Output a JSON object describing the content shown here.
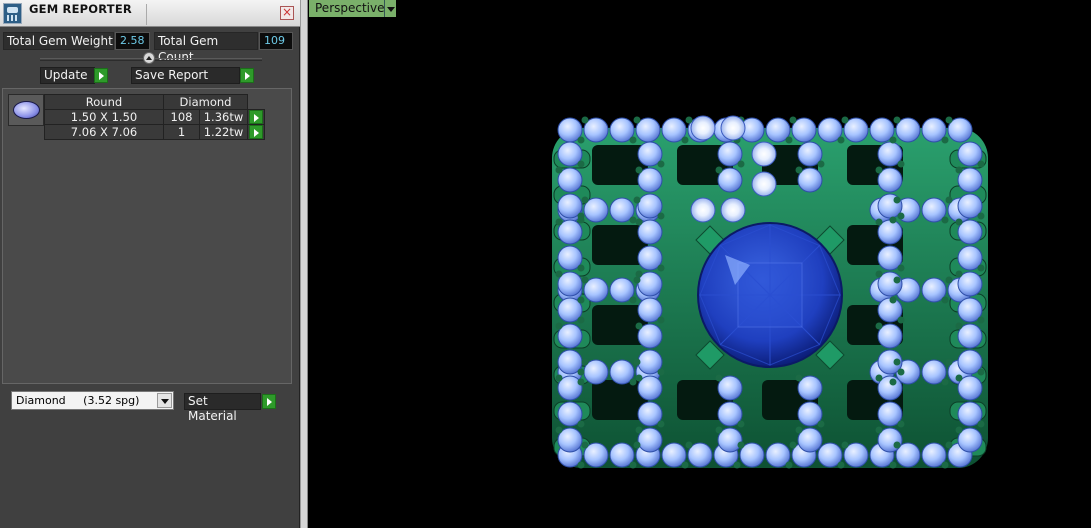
{
  "panel": {
    "title": "GEM REPORTER",
    "close_label": "×",
    "total_weight_label": "Total Gem Weight",
    "total_weight_value": "2.58",
    "total_count_label": "Total Gem Count",
    "total_count_value": "109",
    "update_label": "Update",
    "save_report_label": "Save Report",
    "table": {
      "headers": [
        "Round",
        "Diamond"
      ],
      "rows": [
        {
          "size": "1.50 X 1.50",
          "count": "108",
          "weight": "1.36tw"
        },
        {
          "size": "7.06 X 7.06",
          "count": "1",
          "weight": "1.22tw"
        }
      ]
    },
    "material": {
      "name": "Diamond",
      "density": "(3.52 spg)"
    },
    "set_material_label": "Set Material"
  },
  "viewport": {
    "view_label": "Perspective"
  },
  "colors": {
    "metal_green": "#1f8a5a",
    "gem_light_blue": "#a7c4ff",
    "center_stone_blue": "#1f3fbf",
    "accent_green_button": "#2e9a2a"
  }
}
